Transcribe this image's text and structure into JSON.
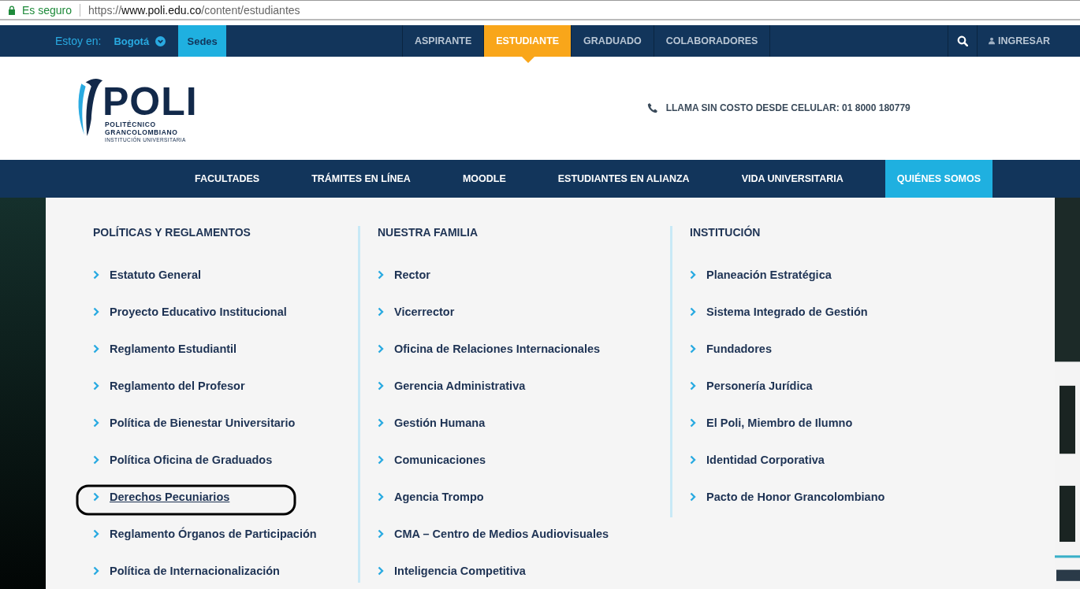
{
  "browser": {
    "security": "Es seguro",
    "url": {
      "scheme": "https://",
      "host": "www.poli.edu.co",
      "path": "/content/estudiantes"
    }
  },
  "top_bar": {
    "location_label": "Estoy en:",
    "city": "Bogotá",
    "sedes": "Sedes",
    "tabs": [
      {
        "label": "ASPIRANTE",
        "selected": false
      },
      {
        "label": "ESTUDIANTE",
        "selected": true
      },
      {
        "label": "GRADUADO",
        "selected": false
      },
      {
        "label": "COLABORADORES",
        "selected": false
      }
    ],
    "login": "INGRESAR"
  },
  "header": {
    "logo": {
      "wordmark": "POLI",
      "line_1": "POLITÉCNICO",
      "line_2": "GRANCOLOMBIANO",
      "line_3": "INSTITUCIÓN UNIVERSITARIA"
    },
    "phone": "LLAMA SIN COSTO DESDE CELULAR: 01 8000 180779"
  },
  "main_nav": [
    {
      "label": "FACULTADES",
      "selected": false
    },
    {
      "label": "TRÁMITES EN LÍNEA",
      "selected": false
    },
    {
      "label": "MOODLE",
      "selected": false
    },
    {
      "label": "ESTUDIANTES EN ALIANZA",
      "selected": false
    },
    {
      "label": "VIDA UNIVERSITARIA",
      "selected": false
    },
    {
      "label": "QUIÉNES SOMOS",
      "selected": true
    }
  ],
  "menu": [
    {
      "heading": "POLÍTICAS Y REGLAMENTOS",
      "items": [
        {
          "label": "Estatuto General",
          "circled": false
        },
        {
          "label": "Proyecto Educativo Institucional",
          "circled": false
        },
        {
          "label": "Reglamento Estudiantil",
          "circled": false
        },
        {
          "label": "Reglamento del Profesor",
          "circled": false
        },
        {
          "label": "Política de Bienestar Universitario",
          "circled": false
        },
        {
          "label": "Política Oficina de Graduados",
          "circled": false
        },
        {
          "label": "Derechos Pecuniarios",
          "circled": true
        },
        {
          "label": "Reglamento Órganos de Participación",
          "circled": false
        },
        {
          "label": "Política de Internacionalización",
          "circled": false
        }
      ]
    },
    {
      "heading": "NUESTRA FAMILIA",
      "items": [
        {
          "label": "Rector",
          "circled": false
        },
        {
          "label": "Vicerrector",
          "circled": false
        },
        {
          "label": "Oficina de Relaciones Internacionales",
          "circled": false
        },
        {
          "label": "Gerencia Administrativa",
          "circled": false
        },
        {
          "label": "Gestión Humana",
          "circled": false
        },
        {
          "label": "Comunicaciones",
          "circled": false
        },
        {
          "label": "Agencia Trompo",
          "circled": false
        },
        {
          "label": "CMA – Centro de Medios Audiovisuales",
          "circled": false
        },
        {
          "label": "Inteligencia Competitiva",
          "circled": false
        }
      ]
    },
    {
      "heading": "INSTITUCIÓN",
      "items": [
        {
          "label": "Planeación Estratégica",
          "circled": false
        },
        {
          "label": "Sistema Integrado de Gestión",
          "circled": false
        },
        {
          "label": "Fundadores",
          "circled": false
        },
        {
          "label": "Personería Jurídica",
          "circled": false
        },
        {
          "label": "El Poli, Miembro de Ilumno",
          "circled": false
        },
        {
          "label": "Identidad Corporativa",
          "circled": false
        },
        {
          "label": "Pacto de Honor Grancolombiano",
          "circled": false
        }
      ]
    }
  ]
}
